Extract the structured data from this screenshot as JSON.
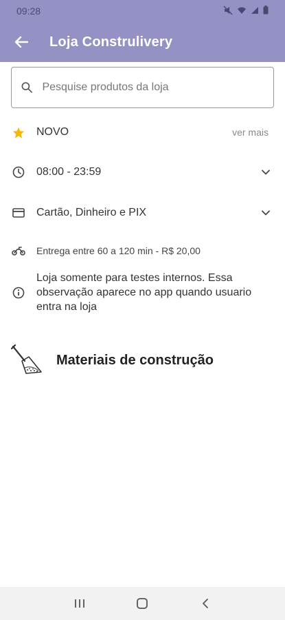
{
  "status_bar": {
    "time": "09:28"
  },
  "app_bar": {
    "title": "Loja Construlivery"
  },
  "search": {
    "placeholder": "Pesquise produtos da loja"
  },
  "store_info": {
    "rating_label": "NOVO",
    "more_label": "ver mais",
    "hours": "08:00 - 23:59",
    "payment": "Cartão, Dinheiro e PIX",
    "delivery": "Entrega entre 60 a 120 min - R$ 20,00",
    "note": "Loja somente para testes internos. Essa observação aparece no app quando usuario entra na loja"
  },
  "categories": [
    {
      "label": "Materiais de construção",
      "icon": "shovel-icon"
    }
  ],
  "colors": {
    "app_bar": "#9491c5",
    "star": "#f5b800"
  }
}
